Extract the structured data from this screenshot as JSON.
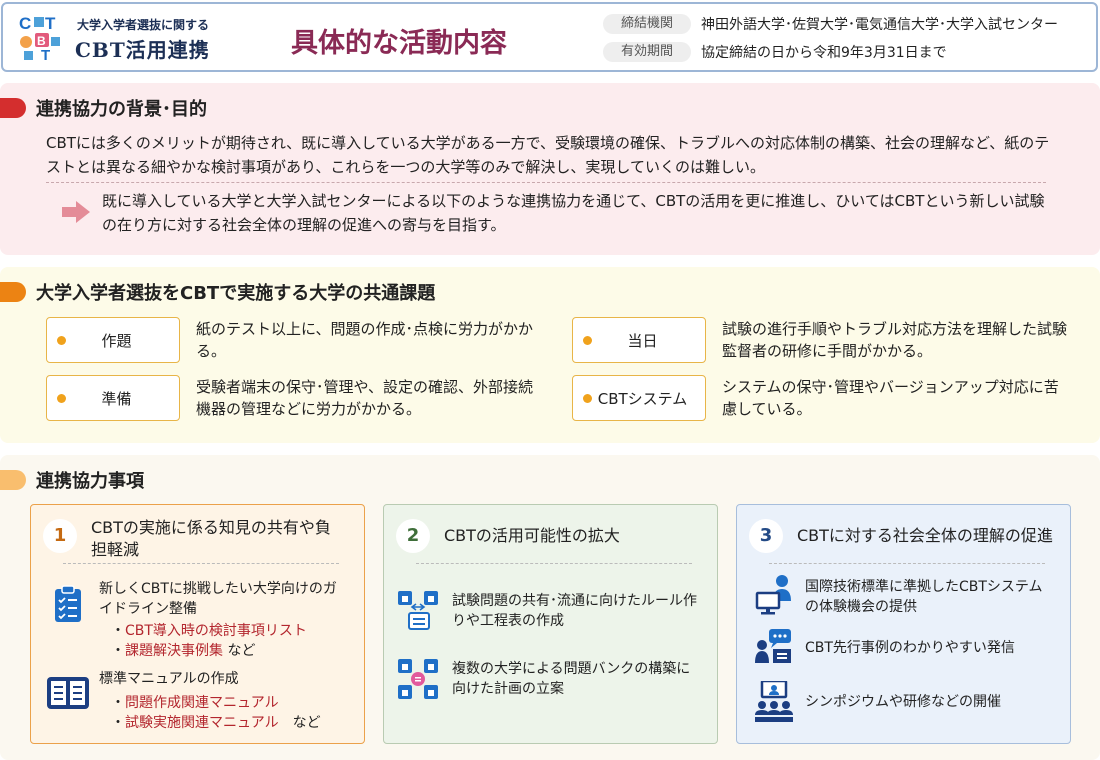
{
  "header": {
    "logo_sub": "大学入学者選抜に関する",
    "logo_main": "CBT活用連携",
    "title": "具体的な活動内容",
    "meta": [
      {
        "label": "締結機関",
        "value": "神田外語大学･佐賀大学･電気通信大学･大学入試センター"
      },
      {
        "label": "有効期間",
        "value": "協定締結の日から令和9年3月31日まで"
      }
    ]
  },
  "background": {
    "title": "連携協力の背景･目的",
    "body": "CBTには多くのメリットが期待され、既に導入している大学がある一方で、受験環境の確保、トラブルへの対応体制の構築、社会の理解など、紙のテストとは異なる細やかな検討事項があり、これらを一つの大学等のみで解決し、実現していくのは難しい。",
    "conclusion": "既に導入している大学と大学入試センターによる以下のような連携協力を通じて、CBTの活用を更に推進し、ひいてはCBTという新しい試験の在り方に対する社会全体の理解の促進への寄与を目指す。"
  },
  "issues": {
    "title": "大学入学者選抜をCBTで実施する大学の共通課題",
    "items": [
      {
        "label": "作題",
        "desc": "紙のテスト以上に、問題の作成･点検に労力がかかる。"
      },
      {
        "label": "当日",
        "desc": "試験の進行手順やトラブル対応方法を理解した試験監督者の研修に手間がかかる。"
      },
      {
        "label": "準備",
        "desc": "受験者端末の保守･管理や、設定の確認、外部接続機器の管理などに労力がかかる。"
      },
      {
        "label": "CBTシステム",
        "desc": "システムの保守･管理やバージョンアップ対応に苦慮している。"
      }
    ]
  },
  "cooperation": {
    "title": "連携協力事項",
    "cards": [
      {
        "num": "1",
        "title": "CBTの実施に係る知見の共有や負担軽減",
        "items": [
          {
            "icon": "checklist-icon",
            "text": "新しくCBTに挑戦したい大学向けのガイドライン整備",
            "subs": [
              {
                "bullet": "・",
                "red": "CBT導入時の検討事項リスト",
                "rest": ""
              },
              {
                "bullet": "・",
                "red": "課題解決事例集",
                "rest": " など"
              }
            ]
          },
          {
            "icon": "manual-icon",
            "text": "標準マニュアルの作成",
            "subs": [
              {
                "bullet": "・",
                "red": "問題作成関連マニュアル",
                "rest": ""
              },
              {
                "bullet": "・",
                "red": "試験実施関連マニュアル",
                "rest": "　など"
              }
            ]
          }
        ]
      },
      {
        "num": "2",
        "title": "CBTの活用可能性の拡大",
        "items": [
          {
            "icon": "share-rules-icon",
            "text": "試験問題の共有･流通に向けたルール作りや工程表の作成"
          },
          {
            "icon": "question-bank-icon",
            "text": "複数の大学による問題バンクの構築に向けた計画の立案"
          }
        ]
      },
      {
        "num": "3",
        "title": "CBTに対する社会全体の理解の促進",
        "items": [
          {
            "icon": "cbt-experience-icon",
            "text": "国際技術標準に準拠したCBTシステムの体験機会の提供"
          },
          {
            "icon": "presentation-icon",
            "text": "CBT先行事例のわかりやすい発信"
          },
          {
            "icon": "symposium-icon",
            "text": "シンポジウムや研修などの開催"
          }
        ]
      }
    ]
  },
  "colors": {
    "accent_red": "#d42e2e",
    "accent_orange": "#ec8313",
    "accent_light_orange": "#f9be6e",
    "title_purple": "#8a2a55",
    "navy": "#1c2f55",
    "icon_blue": "#1f6fc7"
  }
}
